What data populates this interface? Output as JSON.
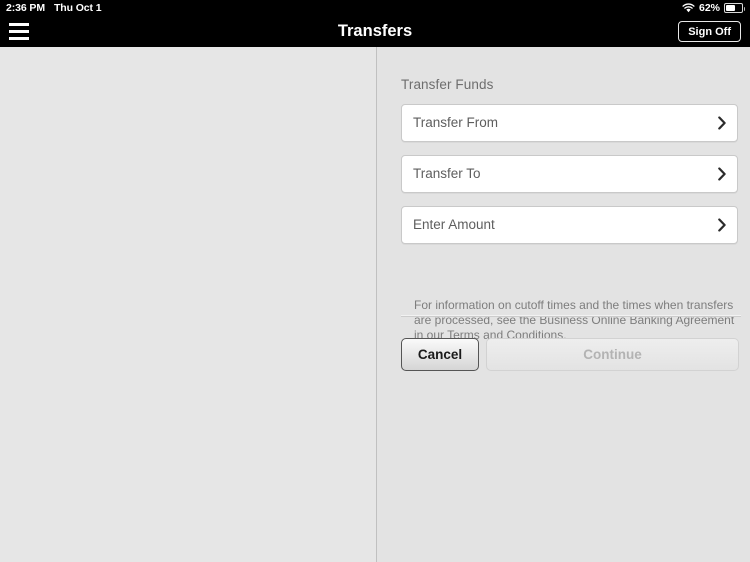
{
  "status_bar": {
    "time": "2:36 PM",
    "date": "Thu Oct 1",
    "wifi_icon": "wifi-icon",
    "battery_percent": "62%",
    "battery_icon": "battery-icon"
  },
  "nav": {
    "menu_icon": "hamburger-menu-icon",
    "title": "Transfers",
    "sign_off_label": "Sign Off"
  },
  "main": {
    "section_title": "Transfer Funds",
    "fields": [
      {
        "label": "Transfer From",
        "value": "",
        "chevron": "chevron-right-icon"
      },
      {
        "label": "Transfer To",
        "value": "",
        "chevron": "chevron-right-icon"
      },
      {
        "label": "Enter Amount",
        "value": "",
        "chevron": "chevron-right-icon"
      }
    ],
    "disclaimer": "For information on cutoff times and the times when transfers are processed, see the Business Online Banking Agreement in our Terms and Conditions.",
    "buttons": {
      "cancel_label": "Cancel",
      "continue_label": "Continue",
      "continue_disabled": true
    }
  },
  "colors": {
    "navbar_bg": "#000000",
    "page_bg": "#e3e3e3",
    "left_pane_bg": "#e6e6e6",
    "field_bg": "#ffffff",
    "label_text": "#5e5e5e",
    "muted_text": "#7d7d7d",
    "disabled_text": "#b3b3b3"
  }
}
